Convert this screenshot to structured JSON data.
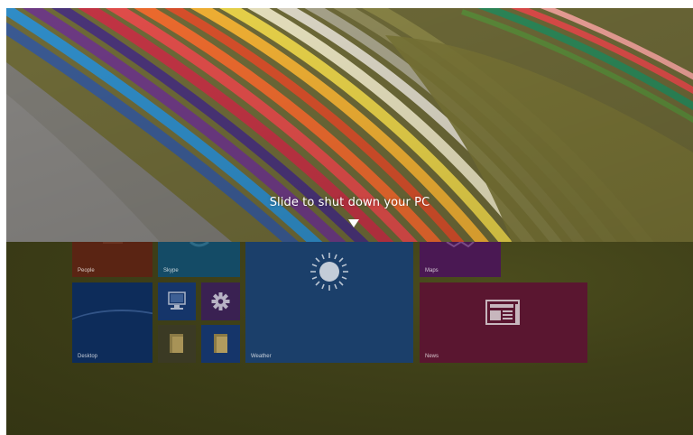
{
  "lock_screen": {
    "message": "Slide to shut down your PC",
    "arrow_icon": "down-arrow-icon"
  },
  "start_screen": {
    "tiles": [
      {
        "label": "People",
        "icon": "people-icon",
        "color": "#5a2413"
      },
      {
        "label": "Skype",
        "icon": "skype-icon",
        "color": "#144b66"
      },
      {
        "label": "Maps",
        "icon": "maps-icon",
        "color": "#4a1853"
      },
      {
        "label": "Desktop",
        "icon": "desktop-icon",
        "color": "#0d2c5a"
      },
      {
        "label": "",
        "icon": "this-pc-icon",
        "color": "#15356a"
      },
      {
        "label": "",
        "icon": "gear-icon",
        "color": "#3a2152"
      },
      {
        "label": "",
        "icon": "folder-icon",
        "color": "#3b3a24"
      },
      {
        "label": "",
        "icon": "file-explorer-icon",
        "color": "#15356a"
      },
      {
        "label": "Weather",
        "icon": "sun-icon",
        "color": "#1b3f6a"
      },
      {
        "label": "News",
        "icon": "news-icon",
        "color": "#5a1630"
      }
    ]
  }
}
